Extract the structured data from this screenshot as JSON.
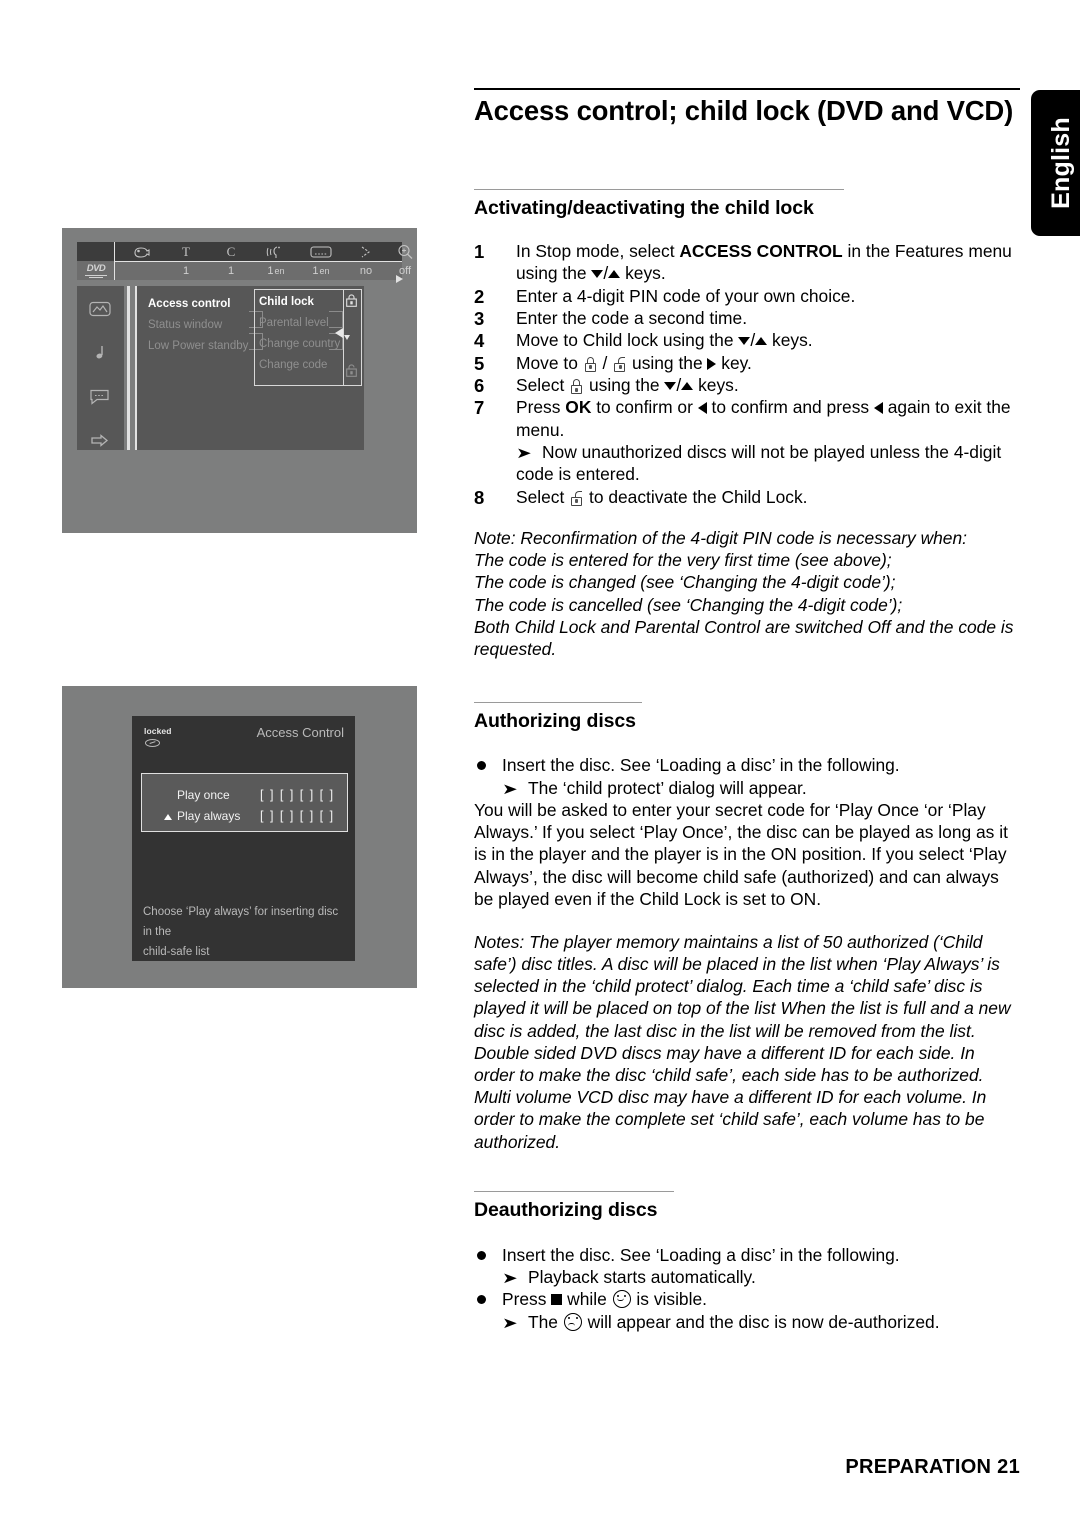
{
  "side_tab": {
    "label": "English"
  },
  "header": {
    "title": "Access control; child lock (DVD and VCD)"
  },
  "sections": {
    "activating": {
      "heading": "Activating/deactivating the child lock",
      "steps": [
        {
          "num": "1",
          "text_a": "In Stop mode, select ",
          "bold": "ACCESS CONTROL",
          "text_b": " in the Features menu using the ",
          "text_c": " keys."
        },
        {
          "num": "2",
          "text": "Enter a 4-digit PIN code of your own choice."
        },
        {
          "num": "3",
          "text": "Enter the code a second time."
        },
        {
          "num": "4",
          "text_a": "Move to Child lock using the ",
          "text_b": " keys."
        },
        {
          "num": "5",
          "text_a": "Move to ",
          "sep": " / ",
          "text_b": " using the ",
          "text_c": " key."
        },
        {
          "num": "6",
          "text_a": "Select ",
          "text_b": " using the ",
          "text_c": " keys."
        },
        {
          "num": "7",
          "text_a": "Press ",
          "bold": "OK",
          "text_b": " to confirm or ",
          "text_c": " to confirm and press ",
          "text_d": " again to exit the menu."
        },
        {
          "num": "8",
          "text_a": "Select ",
          "text_b": " to deactivate the Child Lock."
        }
      ],
      "step7_sub": "Now unauthorized discs will not be played unless the 4-digit code is entered.",
      "notes": [
        "Note: Reconfirmation of the 4-digit PIN code is necessary when:",
        "The code is entered for the very first time (see above);",
        "The code is changed (see ‘Changing the 4-digit code’);",
        "The code is cancelled (see ‘Changing the 4-digit code’);",
        "Both Child Lock and Parental Control are switched Off and the code is requested."
      ]
    },
    "authorizing": {
      "heading": "Authorizing discs",
      "bullet1": "Insert the disc. See ‘Loading a disc’ in the following.",
      "sub1": "The ‘child protect’ dialog will appear.",
      "para": "You will be asked to enter your secret code for ‘Play Once ‘or ‘Play Always.’ If you select ‘Play Once’, the disc can be played as long as it is in the player and the player is in the ON position. If you select ‘Play Always’, the disc will become child safe (authorized) and can always be played even if the Child Lock is set to ON.",
      "notes": [
        "Notes: The player memory maintains a list of 50 authorized (‘Child safe’) disc titles. A disc will be placed in the list when ‘Play Always’ is selected in the ‘child protect’ dialog. Each time a ‘child safe’ disc is played it will be placed on top of the list When the list is full and a new disc is added, the last disc in the list will be removed from the list.",
        "Double sided DVD discs may have a different ID for each side. In order to make the disc ‘child safe’, each side has to be authorized.",
        "Multi volume VCD disc may have a different ID for each volume. In order to make the complete set ‘child safe’, each volume has to be authorized."
      ]
    },
    "deauthorizing": {
      "heading": "Deauthorizing discs",
      "bullet1": "Insert the disc. See ‘Loading a disc’ in the following.",
      "sub1": "Playback starts automatically.",
      "bullet2_a": "Press ",
      "bullet2_b": " while ",
      "bullet2_c": " is visible.",
      "sub2_a": "The ",
      "sub2_b": " will appear and the disc is now de-authorized."
    }
  },
  "osd_menu": {
    "disc_label": "DVD",
    "top_icons": [
      "angle-icon",
      "T",
      "C",
      "audio-icon",
      "subtitle-icon",
      "play-mode-icon",
      "zoom-icon"
    ],
    "top_values": [
      "1",
      "1",
      "1",
      "1",
      "no",
      "off"
    ],
    "top_value_suffix": [
      "",
      "",
      "en",
      "en",
      "",
      ""
    ],
    "rail_icons": [
      "picture-icon",
      "sound-icon",
      "language-icon",
      "features-icon"
    ],
    "column1": [
      {
        "label": "Access control",
        "selected": true
      },
      {
        "label": "Status window",
        "selected": false
      },
      {
        "label": "Low Power standby",
        "selected": false
      }
    ],
    "column2": [
      {
        "label": "Child lock",
        "selected": true
      },
      {
        "label": "Parental level",
        "selected": false
      },
      {
        "label": "Change country",
        "selected": false
      },
      {
        "label": "Change code",
        "selected": false
      }
    ],
    "column3": [
      "lock-closed-icon",
      "lock-open-icon"
    ]
  },
  "osd_dialog": {
    "locked_label": "locked",
    "title": "Access Control",
    "rows": [
      {
        "label": "Play once",
        "selected": false,
        "code": "[ ] [ ] [ ] [ ]"
      },
      {
        "label": "Play always",
        "selected": true,
        "code": "[ ] [ ] [ ] [ ]"
      }
    ],
    "hint_line1": "Choose ‘Play always’ for inserting disc in the",
    "hint_line2": "child-safe list"
  },
  "footer": {
    "text": "PREPARATION 21"
  },
  "colors": {
    "tab_bg": "#000000",
    "osd_outer": "#7d7e7e",
    "osd_panel": "#575757",
    "dialog_bg": "#333333"
  }
}
